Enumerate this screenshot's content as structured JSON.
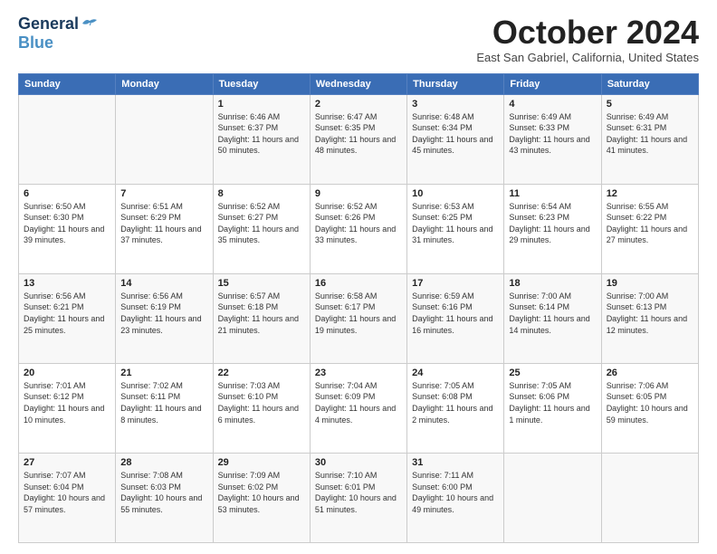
{
  "header": {
    "logo_line1": "General",
    "logo_line2": "Blue",
    "month_title": "October 2024",
    "subtitle": "East San Gabriel, California, United States"
  },
  "columns": [
    "Sunday",
    "Monday",
    "Tuesday",
    "Wednesday",
    "Thursday",
    "Friday",
    "Saturday"
  ],
  "weeks": [
    [
      {
        "day": "",
        "info": ""
      },
      {
        "day": "",
        "info": ""
      },
      {
        "day": "1",
        "info": "Sunrise: 6:46 AM\nSunset: 6:37 PM\nDaylight: 11 hours and 50 minutes."
      },
      {
        "day": "2",
        "info": "Sunrise: 6:47 AM\nSunset: 6:35 PM\nDaylight: 11 hours and 48 minutes."
      },
      {
        "day": "3",
        "info": "Sunrise: 6:48 AM\nSunset: 6:34 PM\nDaylight: 11 hours and 45 minutes."
      },
      {
        "day": "4",
        "info": "Sunrise: 6:49 AM\nSunset: 6:33 PM\nDaylight: 11 hours and 43 minutes."
      },
      {
        "day": "5",
        "info": "Sunrise: 6:49 AM\nSunset: 6:31 PM\nDaylight: 11 hours and 41 minutes."
      }
    ],
    [
      {
        "day": "6",
        "info": "Sunrise: 6:50 AM\nSunset: 6:30 PM\nDaylight: 11 hours and 39 minutes."
      },
      {
        "day": "7",
        "info": "Sunrise: 6:51 AM\nSunset: 6:29 PM\nDaylight: 11 hours and 37 minutes."
      },
      {
        "day": "8",
        "info": "Sunrise: 6:52 AM\nSunset: 6:27 PM\nDaylight: 11 hours and 35 minutes."
      },
      {
        "day": "9",
        "info": "Sunrise: 6:52 AM\nSunset: 6:26 PM\nDaylight: 11 hours and 33 minutes."
      },
      {
        "day": "10",
        "info": "Sunrise: 6:53 AM\nSunset: 6:25 PM\nDaylight: 11 hours and 31 minutes."
      },
      {
        "day": "11",
        "info": "Sunrise: 6:54 AM\nSunset: 6:23 PM\nDaylight: 11 hours and 29 minutes."
      },
      {
        "day": "12",
        "info": "Sunrise: 6:55 AM\nSunset: 6:22 PM\nDaylight: 11 hours and 27 minutes."
      }
    ],
    [
      {
        "day": "13",
        "info": "Sunrise: 6:56 AM\nSunset: 6:21 PM\nDaylight: 11 hours and 25 minutes."
      },
      {
        "day": "14",
        "info": "Sunrise: 6:56 AM\nSunset: 6:19 PM\nDaylight: 11 hours and 23 minutes."
      },
      {
        "day": "15",
        "info": "Sunrise: 6:57 AM\nSunset: 6:18 PM\nDaylight: 11 hours and 21 minutes."
      },
      {
        "day": "16",
        "info": "Sunrise: 6:58 AM\nSunset: 6:17 PM\nDaylight: 11 hours and 19 minutes."
      },
      {
        "day": "17",
        "info": "Sunrise: 6:59 AM\nSunset: 6:16 PM\nDaylight: 11 hours and 16 minutes."
      },
      {
        "day": "18",
        "info": "Sunrise: 7:00 AM\nSunset: 6:14 PM\nDaylight: 11 hours and 14 minutes."
      },
      {
        "day": "19",
        "info": "Sunrise: 7:00 AM\nSunset: 6:13 PM\nDaylight: 11 hours and 12 minutes."
      }
    ],
    [
      {
        "day": "20",
        "info": "Sunrise: 7:01 AM\nSunset: 6:12 PM\nDaylight: 11 hours and 10 minutes."
      },
      {
        "day": "21",
        "info": "Sunrise: 7:02 AM\nSunset: 6:11 PM\nDaylight: 11 hours and 8 minutes."
      },
      {
        "day": "22",
        "info": "Sunrise: 7:03 AM\nSunset: 6:10 PM\nDaylight: 11 hours and 6 minutes."
      },
      {
        "day": "23",
        "info": "Sunrise: 7:04 AM\nSunset: 6:09 PM\nDaylight: 11 hours and 4 minutes."
      },
      {
        "day": "24",
        "info": "Sunrise: 7:05 AM\nSunset: 6:08 PM\nDaylight: 11 hours and 2 minutes."
      },
      {
        "day": "25",
        "info": "Sunrise: 7:05 AM\nSunset: 6:06 PM\nDaylight: 11 hours and 1 minute."
      },
      {
        "day": "26",
        "info": "Sunrise: 7:06 AM\nSunset: 6:05 PM\nDaylight: 10 hours and 59 minutes."
      }
    ],
    [
      {
        "day": "27",
        "info": "Sunrise: 7:07 AM\nSunset: 6:04 PM\nDaylight: 10 hours and 57 minutes."
      },
      {
        "day": "28",
        "info": "Sunrise: 7:08 AM\nSunset: 6:03 PM\nDaylight: 10 hours and 55 minutes."
      },
      {
        "day": "29",
        "info": "Sunrise: 7:09 AM\nSunset: 6:02 PM\nDaylight: 10 hours and 53 minutes."
      },
      {
        "day": "30",
        "info": "Sunrise: 7:10 AM\nSunset: 6:01 PM\nDaylight: 10 hours and 51 minutes."
      },
      {
        "day": "31",
        "info": "Sunrise: 7:11 AM\nSunset: 6:00 PM\nDaylight: 10 hours and 49 minutes."
      },
      {
        "day": "",
        "info": ""
      },
      {
        "day": "",
        "info": ""
      }
    ]
  ]
}
